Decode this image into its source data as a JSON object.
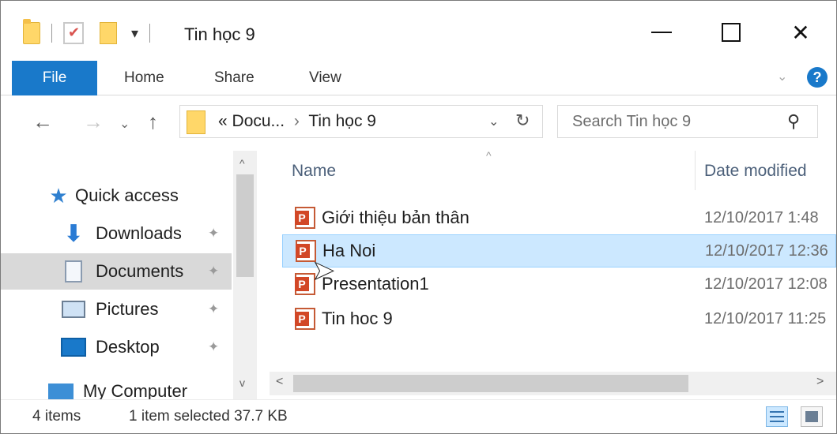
{
  "window": {
    "title": "Tin học 9",
    "controls": {
      "minimize_icon": "minimize-icon",
      "maximize_icon": "maximize-icon",
      "close_icon": "close-icon",
      "close_glyph": "✕"
    }
  },
  "qat": {
    "dropdown_glyph": "▾"
  },
  "ribbon": {
    "tabs": [
      {
        "label": "File",
        "active": true
      },
      {
        "label": "Home"
      },
      {
        "label": "Share"
      },
      {
        "label": "View"
      }
    ],
    "expand_glyph": "⌄",
    "help_glyph": "?"
  },
  "nav": {
    "back_glyph": "←",
    "forward_glyph": "→",
    "recent_glyph": "⌄",
    "up_glyph": "↑",
    "address": {
      "prefix": "«",
      "crumb1": "Docu...",
      "sep": "›",
      "crumb2": "Tin học 9",
      "drop_glyph": "⌄",
      "refresh_glyph": "↻"
    },
    "search": {
      "placeholder": "Search Tin học 9",
      "icon_glyph": "⚲"
    }
  },
  "sidebar": {
    "items": [
      {
        "label": "Quick access",
        "icon": "star-icon",
        "selected": false,
        "pinned": false
      },
      {
        "label": "Downloads",
        "icon": "download-icon",
        "selected": false,
        "pinned": true
      },
      {
        "label": "Documents",
        "icon": "documents-icon",
        "selected": true,
        "pinned": true
      },
      {
        "label": "Pictures",
        "icon": "pictures-icon",
        "selected": false,
        "pinned": true
      },
      {
        "label": "Desktop",
        "icon": "desktop-icon",
        "selected": false,
        "pinned": true
      },
      {
        "label": "My Computer",
        "icon": "computer-icon",
        "selected": false,
        "pinned": false
      }
    ],
    "pin_glyph": "✦",
    "star_glyph": "★",
    "download_glyph": "⬇"
  },
  "filelist": {
    "sort_glyph": "^",
    "columns": {
      "name": "Name",
      "date": "Date modified"
    },
    "rows": [
      {
        "name": "Giới thiệu bản thân",
        "date": "12/10/2017 1:48",
        "selected": false
      },
      {
        "name": "Ha Noi",
        "date": "12/10/2017 12:36",
        "selected": true
      },
      {
        "name": "Presentation1",
        "date": "12/10/2017 12:08",
        "selected": false
      },
      {
        "name": "Tin hoc 9",
        "date": "12/10/2017 11:25",
        "selected": false
      }
    ],
    "hscroll": {
      "left_glyph": "<",
      "right_glyph": ">"
    },
    "vscroll": {
      "up_glyph": "^",
      "down_glyph": "v"
    }
  },
  "status": {
    "count": "4 items",
    "selection": "1 item selected 37.7 KB"
  },
  "cursor_glyph": "➤",
  "colors": {
    "accent": "#1979ca",
    "selection": "#cce8ff",
    "nav_selected": "#d9d9d9"
  }
}
